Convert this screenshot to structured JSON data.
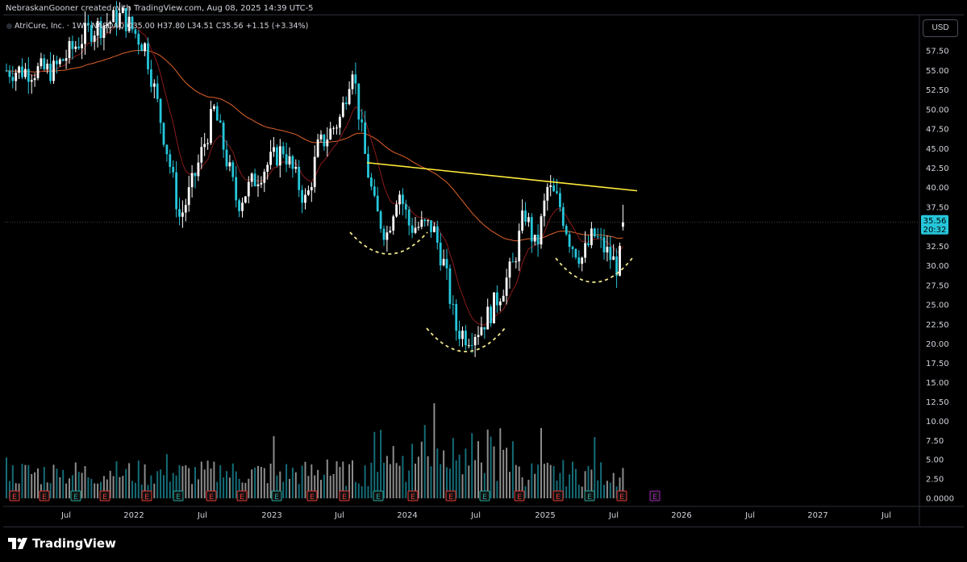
{
  "header": {
    "credit": "NebraskanGooner created with TradingView.com, Aug 08, 2025 14:39 UTC-5"
  },
  "legend": {
    "symbol": "AtriCure, Inc. · 1W · NASDAQ",
    "open": "O35.00",
    "high": "H37.80",
    "low": "L34.51",
    "close": "C35.56",
    "change": "+1.15 (+3.34%)"
  },
  "currency_button": "USD",
  "price_badge": {
    "price": "35.56",
    "countdown": "20:32"
  },
  "footer": {
    "brand": "TradingView"
  },
  "colors": {
    "up": "#ffffff",
    "down": "#26c6da",
    "ema_short": "#8b1a1a",
    "ema_long": "#e0622a",
    "trendline": "#ffeb3b",
    "curves": "#f0e68c",
    "badge": "#26c6da",
    "earnings_past": "#e53935",
    "earnings_future": "#9c27b0"
  },
  "chart_data": {
    "type": "candlestick",
    "symbol": "ATRC",
    "timeframe": "1W",
    "ylim": [
      0,
      60
    ],
    "y_ticks": [
      {
        "v": 57.5,
        "label": "57.50"
      },
      {
        "v": 55,
        "label": "55.00"
      },
      {
        "v": 52.5,
        "label": "52.50"
      },
      {
        "v": 50,
        "label": "50.00"
      },
      {
        "v": 47.5,
        "label": "47.50"
      },
      {
        "v": 45,
        "label": "45.00"
      },
      {
        "v": 42.5,
        "label": "42.50"
      },
      {
        "v": 40,
        "label": "40.00"
      },
      {
        "v": 37.5,
        "label": "37.50"
      },
      {
        "v": 32.5,
        "label": "32.50"
      },
      {
        "v": 30,
        "label": "30.00"
      },
      {
        "v": 27.5,
        "label": "27.50"
      },
      {
        "v": 25,
        "label": "25.00"
      },
      {
        "v": 22.5,
        "label": "22.50"
      },
      {
        "v": 20,
        "label": "20.00"
      },
      {
        "v": 17.5,
        "label": "17.50"
      },
      {
        "v": 15,
        "label": "15.00"
      },
      {
        "v": 12.5,
        "label": "12.50"
      },
      {
        "v": 10,
        "label": "10.00"
      },
      {
        "v": 7.5,
        "label": "7.50"
      },
      {
        "v": 5,
        "label": "5.00"
      },
      {
        "v": 2.5,
        "label": "2.50"
      },
      {
        "v": 0,
        "label": "0.0000"
      }
    ],
    "x_ticks": [
      "Jul",
      "2022",
      "Jul",
      "2023",
      "Jul",
      "2024",
      "Jul",
      "2025",
      "Jul",
      "2026",
      "Jul",
      "2027",
      "Jul"
    ],
    "price_path": [
      {
        "t": "2021-06",
        "p": 55
      },
      {
        "t": "2021-09",
        "p": 60
      },
      {
        "t": "2021-12",
        "p": 62
      },
      {
        "t": "2022-02",
        "p": 58
      },
      {
        "t": "2022-04",
        "p": 44
      },
      {
        "t": "2022-05",
        "p": 36
      },
      {
        "t": "2022-06",
        "p": 40
      },
      {
        "t": "2022-08",
        "p": 50
      },
      {
        "t": "2022-10",
        "p": 38
      },
      {
        "t": "2022-12",
        "p": 42
      },
      {
        "t": "2023-02",
        "p": 45
      },
      {
        "t": "2023-04",
        "p": 38
      },
      {
        "t": "2023-05",
        "p": 45
      },
      {
        "t": "2023-07",
        "p": 49
      },
      {
        "t": "2023-08",
        "p": 56
      },
      {
        "t": "2023-09",
        "p": 45
      },
      {
        "t": "2023-10",
        "p": 37
      },
      {
        "t": "2023-11",
        "p": 34
      },
      {
        "t": "2023-12",
        "p": 40
      },
      {
        "t": "2024-01",
        "p": 35
      },
      {
        "t": "2024-03",
        "p": 35
      },
      {
        "t": "2024-04",
        "p": 30
      },
      {
        "t": "2024-05",
        "p": 22
      },
      {
        "t": "2024-06",
        "p": 21
      },
      {
        "t": "2024-07",
        "p": 22
      },
      {
        "t": "2024-08",
        "p": 24
      },
      {
        "t": "2024-10",
        "p": 30
      },
      {
        "t": "2024-11",
        "p": 37
      },
      {
        "t": "2024-12",
        "p": 32
      },
      {
        "t": "2025-01",
        "p": 40
      },
      {
        "t": "2025-02",
        "p": 38
      },
      {
        "t": "2025-03",
        "p": 33
      },
      {
        "t": "2025-04",
        "p": 31
      },
      {
        "t": "2025-05",
        "p": 34
      },
      {
        "t": "2025-06",
        "p": 32
      },
      {
        "t": "2025-07",
        "p": 30
      },
      {
        "t": "2025-08",
        "p": 35.56
      }
    ],
    "last": {
      "open": 35.0,
      "high": 37.8,
      "low": 34.51,
      "close": 35.56,
      "change": 1.15,
      "change_pct": 3.34
    }
  }
}
